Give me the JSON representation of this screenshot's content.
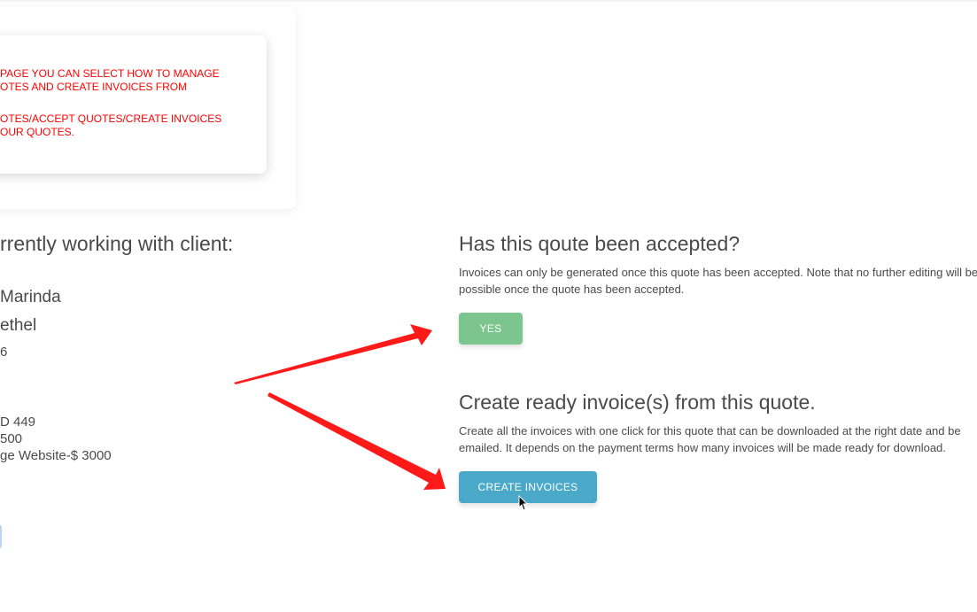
{
  "info_box": {
    "lines_1": "PAGE YOU CAN SELECT HOW TO MANAGE\nOTES AND CREATE INVOICES FROM",
    "lines_2": "OTES/ACCEPT QUOTES/CREATE INVOICES\nOUR QUOTES."
  },
  "client": {
    "heading": "rrently working with client:",
    "name": "Marinda",
    "surname": "ethel",
    "number": "6",
    "items": [
      "D 449",
      " 500",
      "ge Website-$ 3000"
    ]
  },
  "accept_section": {
    "title": "Has this qoute been accepted?",
    "description": "Invoices can only be generated once this quote has been accepted. Note that no further editing will be possible once the quote has been accepted.",
    "yes_label": "YES"
  },
  "invoice_section": {
    "title": "Create ready invoice(s) from this quote.",
    "description": "Create all the invoices with one click for this quote that can be downloaded at the right date and be emailed. It depends on the payment terms how many invoices will be made ready for download.",
    "create_label": "CREATE INVOICES"
  },
  "colors": {
    "yes_button": "#7dc58f",
    "create_button": "#4aa9c9",
    "annotation_red": "#ff0000",
    "info_text": "#ff0000"
  },
  "icons": [
    "arrow-annotation",
    "mouse-cursor-icon"
  ]
}
